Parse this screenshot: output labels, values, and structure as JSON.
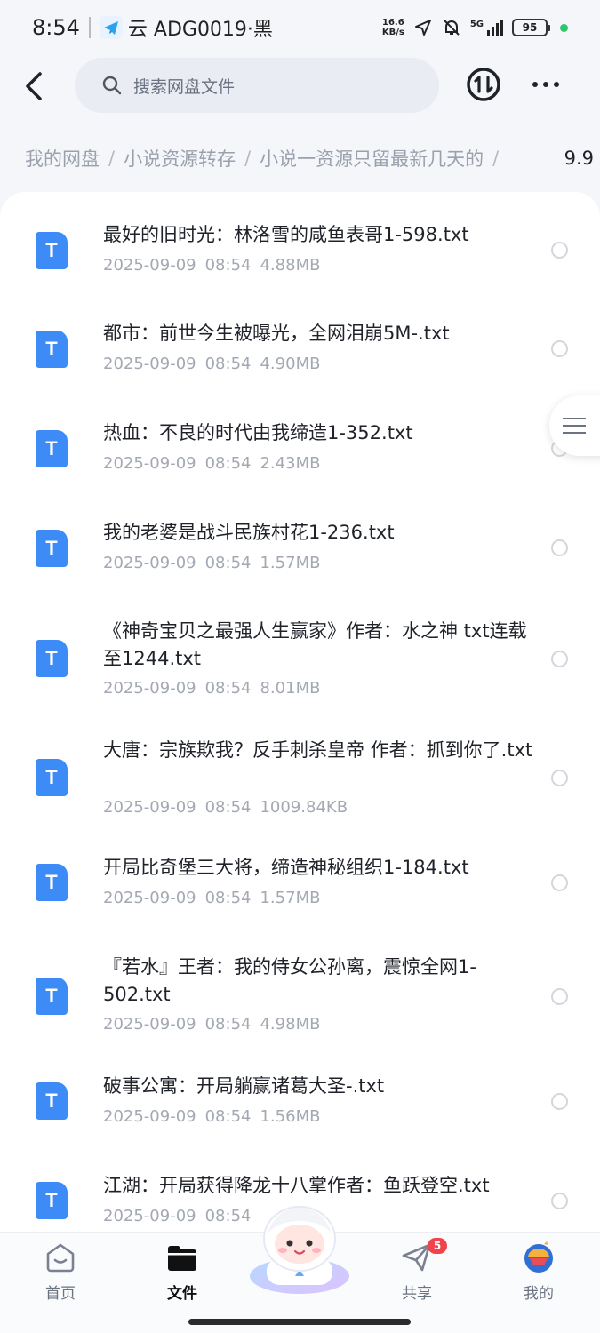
{
  "status_bar": {
    "time": "8:54",
    "carrier": "云 ADG0019·黑",
    "net_speed_value": "16.6",
    "net_speed_unit": "KB/s",
    "signal": "5G",
    "battery": "95"
  },
  "header": {
    "search_placeholder": "搜索网盘文件"
  },
  "breadcrumb": {
    "items": [
      "我的网盘",
      "小说资源转存",
      "小说一资源只留最新几天的"
    ],
    "separator": "/",
    "current": "9.9"
  },
  "files": [
    {
      "icon": "T",
      "name": "最好的旧时光：林洛雪的咸鱼表哥1-598.txt",
      "date": "2025-09-09",
      "time": "08:54",
      "size": "4.88MB"
    },
    {
      "icon": "T",
      "name": "都市：前世今生被曝光，全网泪崩5M-.txt",
      "date": "2025-09-09",
      "time": "08:54",
      "size": "4.90MB"
    },
    {
      "icon": "T",
      "name": "热血：不良的时代由我缔造1-352.txt",
      "date": "2025-09-09",
      "time": "08:54",
      "size": "2.43MB"
    },
    {
      "icon": "T",
      "name": "我的老婆是战斗民族村花1-236.txt",
      "date": "2025-09-09",
      "time": "08:54",
      "size": "1.57MB"
    },
    {
      "icon": "T",
      "name": "《神奇宝贝之最强人生赢家》作者：水之神 txt连载至1244.txt",
      "date": "2025-09-09",
      "time": "08:54",
      "size": "8.01MB"
    },
    {
      "icon": "T",
      "name": "大唐：宗族欺我？反手刺杀皇帝 作者：抓到你了.txt",
      "date": "2025-09-09",
      "time": "08:54",
      "size": "1009.84KB"
    },
    {
      "icon": "T",
      "name": "开局比奇堡三大将，缔造神秘组织1-184.txt",
      "date": "2025-09-09",
      "time": "08:54",
      "size": "1.57MB"
    },
    {
      "icon": "T",
      "name": "『若水』王者：我的侍女公孙离，震惊全网1-502.txt",
      "date": "2025-09-09",
      "time": "08:54",
      "size": "4.98MB"
    },
    {
      "icon": "T",
      "name": "破事公寓：开局躺赢诸葛大圣-.txt",
      "date": "2025-09-09",
      "time": "08:54",
      "size": "1.56MB"
    },
    {
      "icon": "T",
      "name": "江湖：开局获得降龙十八掌作者：鱼跃登空.txt",
      "date": "2025-09-09",
      "time": "08:54",
      "size": ""
    }
  ],
  "bottom_nav": {
    "items": [
      {
        "label": "首页",
        "icon": "home-face-icon"
      },
      {
        "label": "文件",
        "icon": "folder-icon"
      },
      {
        "label": "共享",
        "icon": "paper-plane-icon",
        "badge": "5"
      },
      {
        "label": "我的",
        "icon": "avatar-icon"
      }
    ]
  },
  "colors": {
    "accent": "#3d8bf7",
    "badge": "#f0434c",
    "background": "#f4f6fa"
  }
}
